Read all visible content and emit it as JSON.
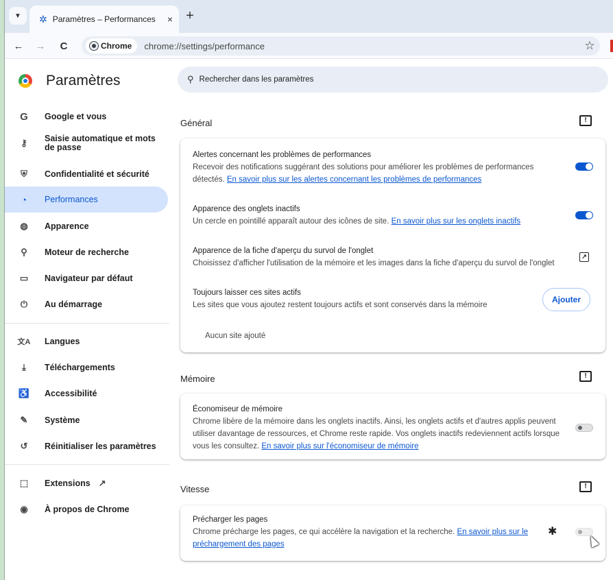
{
  "tab": {
    "title": "Paramètres – Performances",
    "close": "×",
    "new_tab": "+"
  },
  "toolbar": {
    "back": "←",
    "forward": "→",
    "reload": "C",
    "chip_label": "Chrome",
    "url": "chrome://settings/performance",
    "bookmark": "☆"
  },
  "sidebar": {
    "title": "Paramètres",
    "items": [
      {
        "icon": "G",
        "label": "Google et vous"
      },
      {
        "icon": "⚷",
        "label": "Saisie automatique et mots de passe"
      },
      {
        "icon": "⛨",
        "label": "Confidentialité et sécurité"
      },
      {
        "icon": "◔",
        "label": "Performances"
      },
      {
        "icon": "◍",
        "label": "Apparence"
      },
      {
        "icon": "⚲",
        "label": "Moteur de recherche"
      },
      {
        "icon": "▭",
        "label": "Navigateur par défaut"
      },
      {
        "icon": "⏻",
        "label": "Au démarrage"
      },
      {
        "icon": "文A",
        "label": "Langues"
      },
      {
        "icon": "⤓",
        "label": "Téléchargements"
      },
      {
        "icon": "♿",
        "label": "Accessibilité"
      },
      {
        "icon": "✎",
        "label": "Système"
      },
      {
        "icon": "↺",
        "label": "Réinitialiser les paramètres"
      },
      {
        "icon": "⬚",
        "label": "Extensions"
      },
      {
        "icon": "◉",
        "label": "À propos de Chrome"
      }
    ],
    "external_link_glyph": "↗"
  },
  "search": {
    "placeholder": "Rechercher dans les paramètres"
  },
  "sections": {
    "general": {
      "title": "Général",
      "rows": [
        {
          "title": "Alertes concernant les problèmes de performances",
          "desc": "Recevoir des notifications suggérant des solutions pour améliorer les problèmes de performances détectés.",
          "link": "En savoir plus sur les alertes concernant les problèmes de performances",
          "toggle": "on"
        },
        {
          "title": "Apparence des onglets inactifs",
          "desc": "Un cercle en pointillé apparaît autour des icônes de site.",
          "link": "En savoir plus sur les onglets inactifs",
          "toggle": "on"
        },
        {
          "title": "Apparence de la fiche d'aperçu du survol de l'onglet",
          "desc": "Choisissez d'afficher l'utilisation de la mémoire et les images dans la fiche d'aperçu du survol de l'onglet"
        },
        {
          "title": "Toujours laisser ces sites actifs",
          "desc": "Les sites que vous ajoutez restent toujours actifs et sont conservés dans la mémoire",
          "button": "Ajouter",
          "empty": "Aucun site ajouté"
        }
      ]
    },
    "memory": {
      "title": "Mémoire",
      "rows": [
        {
          "title": "Économiseur de mémoire",
          "desc": "Chrome libère de la mémoire dans les onglets inactifs. Ainsi, les onglets actifs et d'autres applis peuvent utiliser davantage de ressources, et Chrome reste rapide. Vos onglets inactifs redeviennent actifs lorsque vous les consultez.",
          "link": "En savoir plus sur l'économiseur de mémoire",
          "toggle": "off"
        }
      ]
    },
    "speed": {
      "title": "Vitesse",
      "rows": [
        {
          "title": "Précharger les pages",
          "desc": "Chrome précharge les pages, ce qui accélère la navigation et la recherche.",
          "link": "En savoir plus sur le préchargement des pages",
          "toggle": "off-disabled"
        }
      ]
    }
  }
}
